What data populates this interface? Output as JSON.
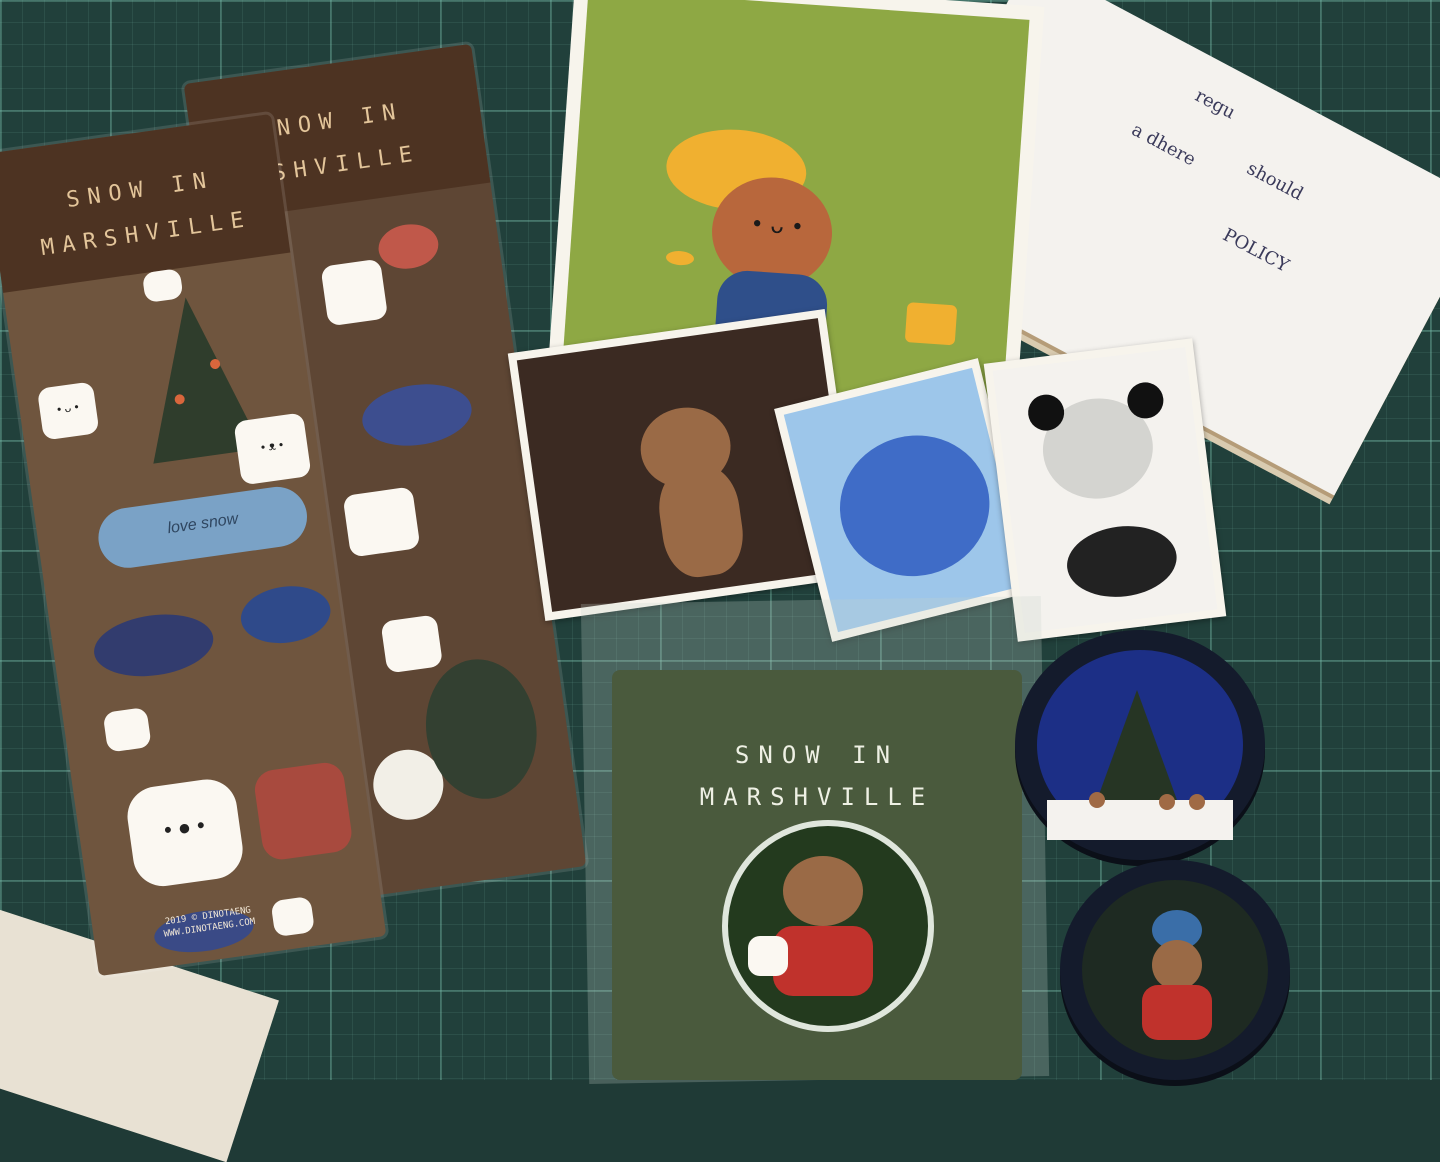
{
  "sticker_sheet": {
    "title_line1": "SNOW IN",
    "title_line2": "MARSHVILLE",
    "back_title_line1": "NOW IN",
    "back_title_line2": "SHVILLE",
    "sticker_text": "love snow",
    "footer_line1": "2019 © DINOTAENG",
    "footer_line2": "WWW.DINOTAENG.COM"
  },
  "badge_package": {
    "title_line1": "SNOW IN",
    "title_line2": "MARSHVILLE"
  },
  "notebook": {
    "words": [
      "regu",
      "a dhere",
      "should",
      "POLICY"
    ]
  },
  "colors": {
    "mat": "#21403b",
    "sheet_brown": "#6f553e",
    "postcard_green": "#8ea844",
    "badge_card_green": "#4a5a3d",
    "tape_navy": "#1c2f86"
  }
}
